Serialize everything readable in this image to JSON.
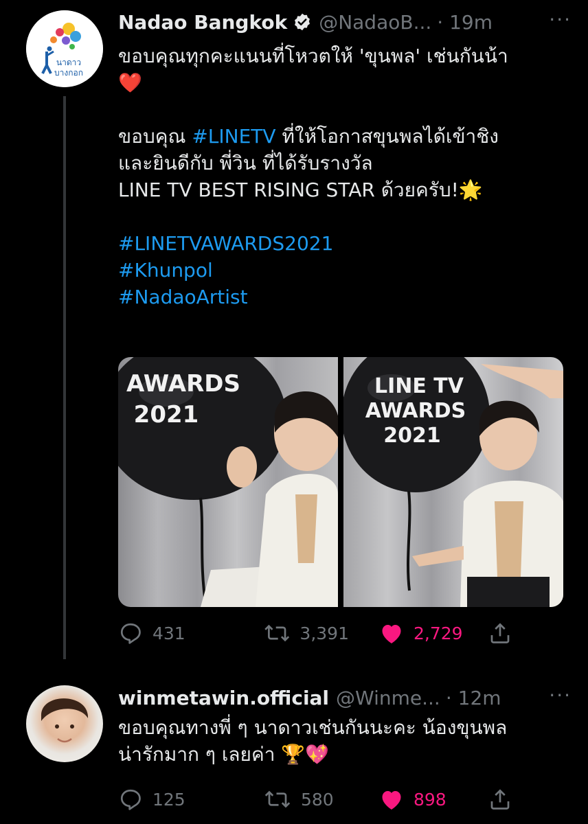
{
  "tweets": [
    {
      "display_name": "Nadao Bangkok",
      "handle": "@NadaoB...",
      "time": "· 19m",
      "more": "···",
      "logo_text": [
        "นาดาว",
        "บางกอก"
      ],
      "lines": [
        [
          {
            "t": "ขอบคุณทุกคะแนนที่โหวตให้ 'ขุนพล' เช่นกันน้า"
          }
        ],
        [
          {
            "t": "❤️"
          }
        ],
        [
          {
            "t": ""
          }
        ],
        [
          {
            "t": "ขอบคุณ "
          },
          {
            "t": "#LINETV",
            "tag": true
          },
          {
            "t": " ที่ให้โอกาสขุนพลได้เข้าชิง"
          }
        ],
        [
          {
            "t": "และยินดีกับ พี่วิน ที่ได้รับรางวัล"
          }
        ],
        [
          {
            "t": "LINE TV BEST RISING STAR ด้วยครับ!🌟"
          }
        ],
        [
          {
            "t": ""
          }
        ],
        [
          {
            "t": "#LINETVAWARDS2021",
            "tag": true
          }
        ],
        [
          {
            "t": "#Khunpol",
            "tag": true
          }
        ],
        [
          {
            "t": "#NadaoArtist",
            "tag": true
          }
        ]
      ],
      "photos": [
        {
          "balloon_text": [
            "AWARDS",
            "2021"
          ]
        },
        {
          "balloon_text": [
            "LINE TV",
            "AWARDS",
            "2021"
          ]
        }
      ],
      "replies": "431",
      "retweets": "3,391",
      "likes": "2,729"
    },
    {
      "display_name": "winmetawin.official",
      "handle": "@Winme...",
      "time": "· 12m",
      "more": "···",
      "lines": [
        [
          {
            "t": "ขอบคุณทางพี่ ๆ นาดาวเช่นกันนะคะ น้องขุนพล"
          }
        ],
        [
          {
            "t": "น่ารักมาก ๆ เลยค่า 🏆💖"
          }
        ]
      ],
      "replies": "125",
      "retweets": "580",
      "likes": "898"
    }
  ],
  "colors": {
    "accent": "#1d9bf0",
    "like": "#f91880",
    "muted": "#71767b",
    "text": "#e7e9ea",
    "background": "#000000"
  }
}
